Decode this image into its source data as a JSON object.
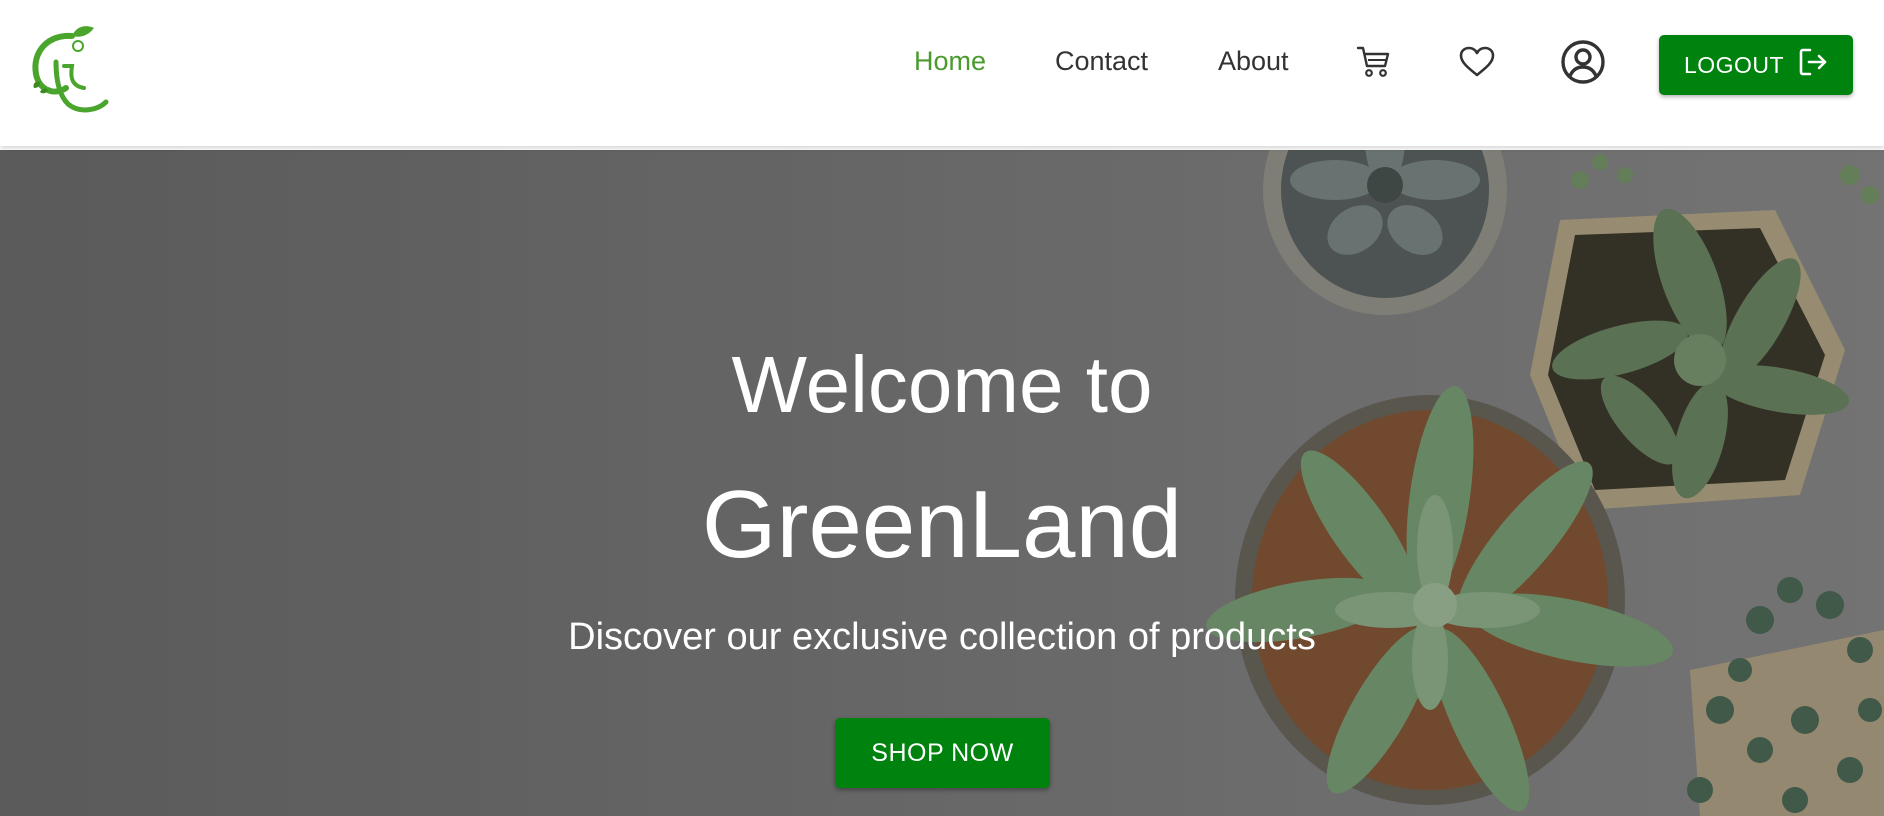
{
  "brand": {
    "logo_icon": "greenland-gl-logo-icon",
    "accent_color": "#4a9a2e",
    "button_color": "#00820e"
  },
  "nav": {
    "items": [
      {
        "label": "Home",
        "active": true
      },
      {
        "label": "Contact",
        "active": false
      },
      {
        "label": "About",
        "active": false
      }
    ],
    "icons": [
      "cart-icon",
      "heart-icon",
      "user-account-icon"
    ],
    "logout": {
      "label": "LOGOUT",
      "icon": "logout-icon"
    }
  },
  "hero": {
    "title_line1": "Welcome to",
    "title_line2": "GreenLand",
    "subtitle": "Discover our exclusive collection of products",
    "cta_label": "SHOP NOW",
    "background": "succulent-plants-photo"
  }
}
